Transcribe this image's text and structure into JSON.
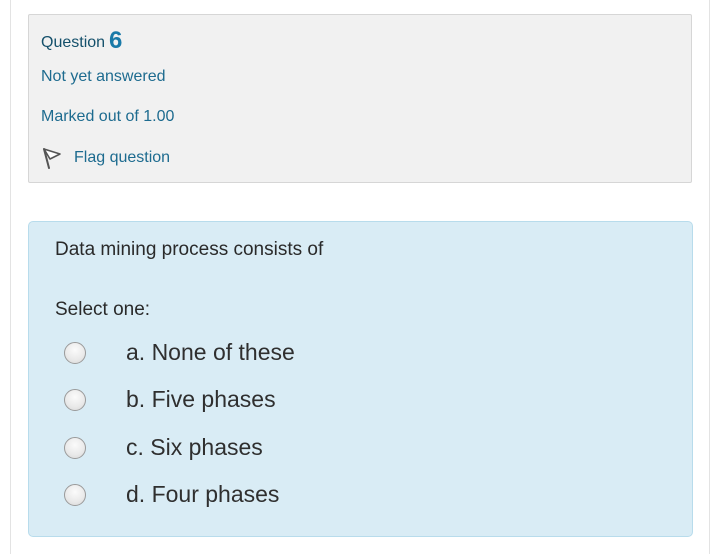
{
  "question_info": {
    "title_label": "Question",
    "number": "6",
    "state": "Not yet answered",
    "grade": "Marked out of 1.00",
    "flag_label": "Flag question"
  },
  "question": {
    "text": "Data mining process consists of",
    "prompt": "Select one:",
    "options": [
      {
        "label": "a. None of these",
        "selected": false
      },
      {
        "label": "b. Five phases",
        "selected": false
      },
      {
        "label": "c. Six phases",
        "selected": false
      },
      {
        "label": "d. Four phases",
        "selected": false
      }
    ]
  },
  "colors": {
    "info_background": "#f1f1f1",
    "content_background": "#d9ecf5",
    "link_text": "#1d6b8f",
    "question_number": "#1a7aa8"
  },
  "icons": {
    "flag": "flag-icon",
    "radio": "radio-unchecked-icon"
  }
}
